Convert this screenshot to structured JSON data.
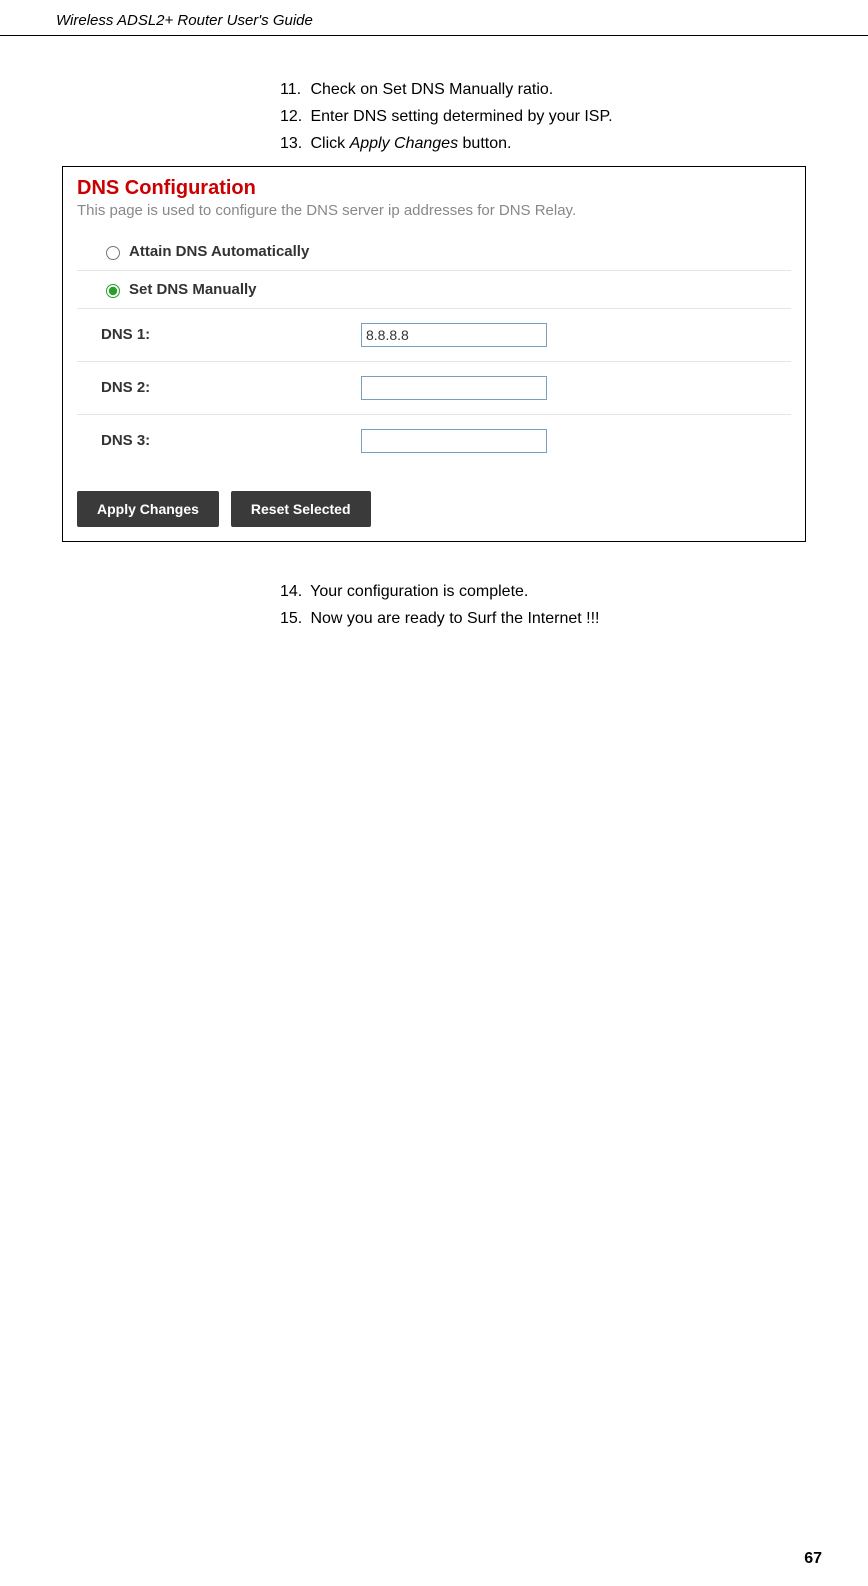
{
  "header": {
    "title": "Wireless ADSL2+ Router User's Guide"
  },
  "instructions_before": [
    {
      "num": "11.",
      "text": "Check on Set DNS Manually ratio."
    },
    {
      "num": "12.",
      "text": "Enter DNS setting determined by your ISP."
    },
    {
      "num": "13.",
      "text_prefix": "Click ",
      "italic": "Apply Changes",
      "text_suffix": " button."
    }
  ],
  "dns_panel": {
    "title": "DNS Configuration",
    "description": "This page is used to configure the DNS server ip addresses for DNS Relay.",
    "radio_auto": "Attain DNS Automatically",
    "radio_manual": "Set DNS Manually",
    "dns1_label": "DNS 1:",
    "dns1_value": "8.8.8.8",
    "dns2_label": "DNS 2:",
    "dns2_value": "",
    "dns3_label": "DNS 3:",
    "dns3_value": "",
    "apply_button": "Apply Changes",
    "reset_button": "Reset Selected"
  },
  "instructions_after": [
    {
      "num": "14.",
      "text": "Your configuration is complete."
    },
    {
      "num": "15.",
      "text": "Now you are ready to Surf the Internet !!!"
    }
  ],
  "page_number": "67"
}
